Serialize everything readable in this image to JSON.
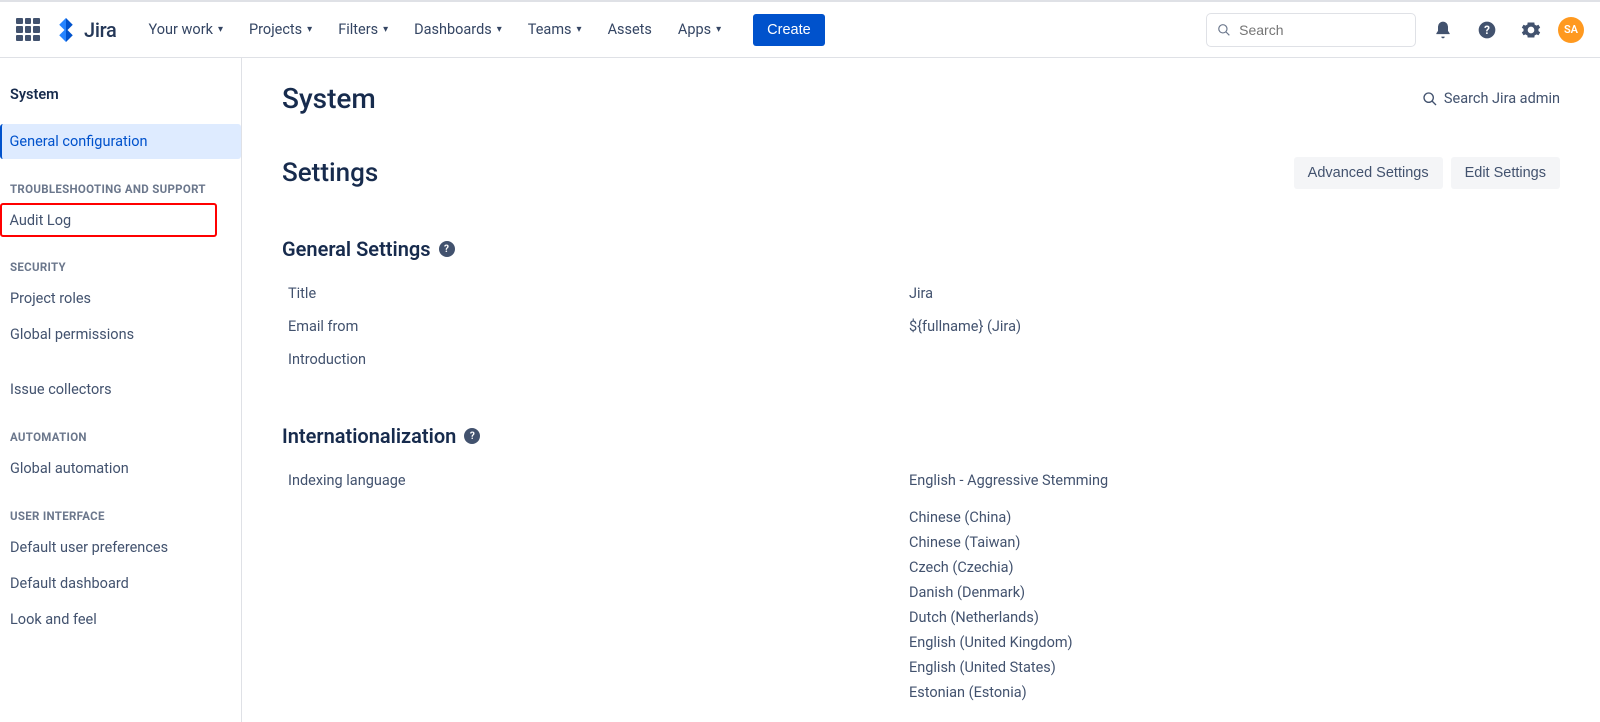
{
  "header": {
    "logo_text": "Jira",
    "nav": [
      {
        "label": "Your work"
      },
      {
        "label": "Projects"
      },
      {
        "label": "Filters"
      },
      {
        "label": "Dashboards"
      },
      {
        "label": "Teams"
      },
      {
        "label": "Assets",
        "no_chevron": true
      },
      {
        "label": "Apps"
      }
    ],
    "create_label": "Create",
    "search_placeholder": "Search",
    "avatar_initials": "SA"
  },
  "sidebar": {
    "title": "System",
    "items": {
      "general_config": "General configuration",
      "troubleshooting_header": "Troubleshooting and support",
      "audit_log": "Audit Log",
      "security_header": "Security",
      "project_roles": "Project roles",
      "global_permissions": "Global permissions",
      "issue_collectors": "Issue collectors",
      "automation_header": "Automation",
      "global_automation": "Global automation",
      "user_interface_header": "User interface",
      "default_user_prefs": "Default user preferences",
      "default_dashboard": "Default dashboard",
      "look_and_feel": "Look and feel"
    }
  },
  "main": {
    "page_title": "System",
    "search_admin_label": "Search Jira admin",
    "settings_heading": "Settings",
    "advanced_settings_label": "Advanced Settings",
    "edit_settings_label": "Edit Settings",
    "general_settings_heading": "General Settings",
    "general_settings": {
      "title_key": "Title",
      "title_value": "Jira",
      "email_from_key": "Email from",
      "email_from_value": "${fullname} (Jira)",
      "introduction_key": "Introduction",
      "introduction_value": ""
    },
    "i18n_heading": "Internationalization",
    "i18n": {
      "indexing_language_key": "Indexing language",
      "indexing_language_value": "English - Aggressive Stemming",
      "languages": [
        "Chinese (China)",
        "Chinese (Taiwan)",
        "Czech (Czechia)",
        "Danish (Denmark)",
        "Dutch (Netherlands)",
        "English (United Kingdom)",
        "English (United States)",
        "Estonian (Estonia)"
      ]
    }
  }
}
